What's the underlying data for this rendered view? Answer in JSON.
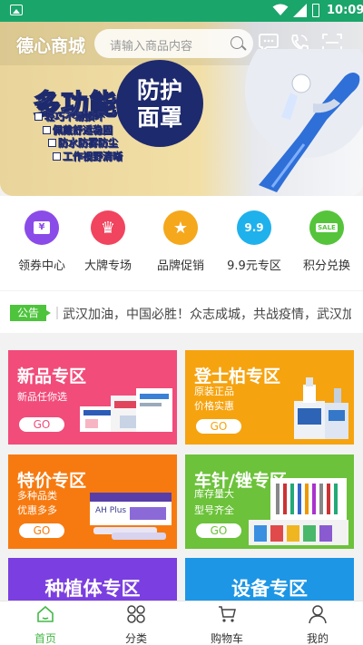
{
  "status_bar": {
    "time": "10:09"
  },
  "header": {
    "logo": "德心商城",
    "search_placeholder": "请输入商品内容"
  },
  "banner": {
    "title": "多功能",
    "badge_line1": "防护",
    "badge_line2": "面罩",
    "features": [
      "轻巧不易损坏",
      "佩戴舒适稳固",
      "防水防雾防尘",
      "工作视野清晰"
    ],
    "pager_count": 3,
    "pager_active": 1
  },
  "quick_menu": [
    {
      "label": "领券中心",
      "icon": "coupon-icon",
      "color": "#8b4be8",
      "glyph": "¥"
    },
    {
      "label": "大牌专场",
      "icon": "crown-icon",
      "color": "#f1445e",
      "glyph": "♛"
    },
    {
      "label": "品牌促销",
      "icon": "star-icon",
      "color": "#f5a81c",
      "glyph": "★"
    },
    {
      "label": "9.9元专区",
      "icon": "price-99-icon",
      "color": "#1fb1ec",
      "glyph": "9.9"
    },
    {
      "label": "积分兑换",
      "icon": "sale-icon",
      "color": "#55c43b",
      "glyph": "SALE"
    }
  ],
  "notice": {
    "tag": "公告",
    "text": "武汉加油，中国必胜！众志成城，共战疫情，武汉加油"
  },
  "zones": [
    {
      "title": "新品专区",
      "subtitle": [
        "新品任你选"
      ],
      "button": "GO",
      "color": "#f14c7a"
    },
    {
      "title": "登士柏专区",
      "subtitle": [
        "原装正品",
        "价格实惠"
      ],
      "button": "GO",
      "color": "#f6a310"
    },
    {
      "title": "特价专区",
      "subtitle": [
        "多种品类",
        "优惠多多"
      ],
      "button": "GO",
      "color": "#f77a10"
    },
    {
      "title": "车针/锉专区",
      "subtitle": [
        "库存量大",
        "型号齐全"
      ],
      "button": "GO",
      "color": "#6cc23a"
    },
    {
      "title": "种植体专区",
      "color": "#7b3ee0"
    },
    {
      "title": "设备专区",
      "color": "#1d96e6"
    }
  ],
  "tabbar": [
    {
      "label": "首页",
      "icon": "home-icon",
      "active": true
    },
    {
      "label": "分类",
      "icon": "category-icon",
      "active": false
    },
    {
      "label": "购物车",
      "icon": "cart-icon",
      "active": false
    },
    {
      "label": "我的",
      "icon": "user-icon",
      "active": false
    }
  ],
  "colors": {
    "status_bar": "#1aa56b",
    "accent": "#44b848",
    "notice_tag": "#4dc43c"
  }
}
